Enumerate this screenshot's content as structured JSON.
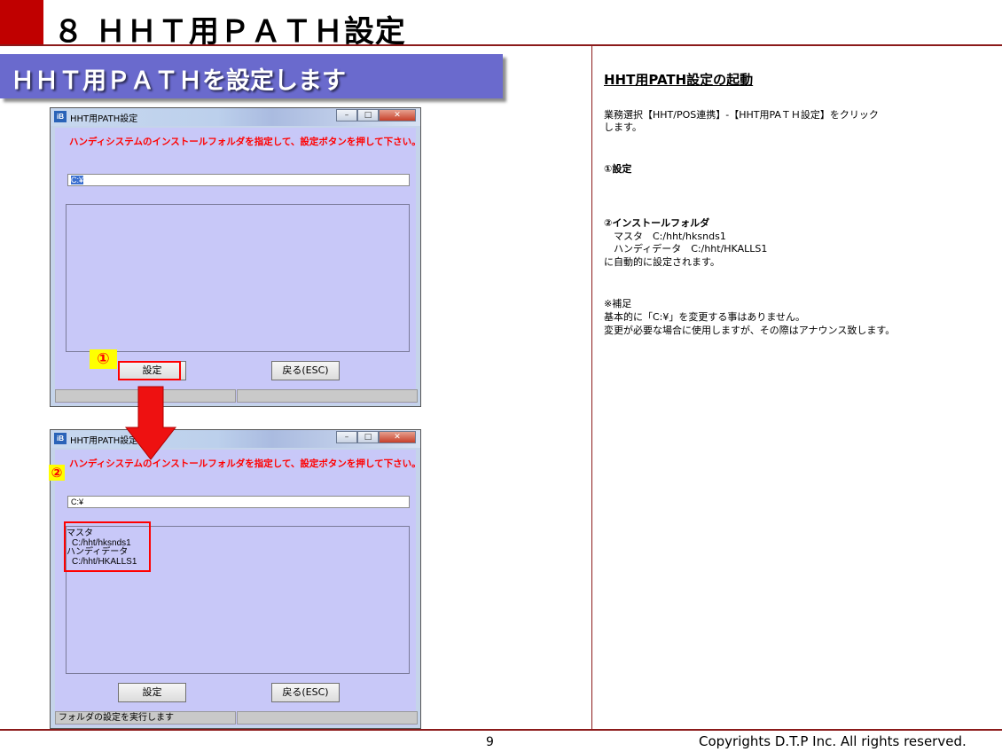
{
  "header": {
    "title": "８ ＨＨＴ用ＰＡＴＨ設定"
  },
  "banner": {
    "text": "ＨＨＴ用ＰＡＴＨを設定します"
  },
  "window1": {
    "title": "HHT用PATH設定",
    "instruction": "ハンディシステムのインストールフォルダを指定して、設定ボタンを押して下さい。",
    "path_value": "C:¥",
    "set_button": "設定",
    "back_button": "戻る(ESC)",
    "status_left": "",
    "status_right": ""
  },
  "window2": {
    "title": "HHT用PATH設定",
    "instruction": "ハンディシステムのインストールフォルダを指定して、設定ボタンを押して下さい。",
    "path_value": "C:¥",
    "list_lines": [
      "マスタ",
      "  C:/hht/hksnds1",
      "ハンディデータ",
      "  C:/hht/HKALLS1"
    ],
    "set_button": "設定",
    "back_button": "戻る(ESC)",
    "status_left": "フォルダの設定を実行します",
    "status_right": ""
  },
  "markers": {
    "step1": "①",
    "step2": "②"
  },
  "colors": {
    "accent_red": "#c00000",
    "banner": "#6a6acd",
    "client_bg": "#c8c8f8",
    "marker_bg": "#ffff00"
  },
  "right_panel": {
    "heading": "HHT用PATH設定の起動",
    "intro_lines": [
      "業務選択【HHT/POS連携】-【HHT用PAＴＨ設定】をクリック",
      "します。"
    ],
    "step1_label": "①設定",
    "step2_label": "②インストールフォルダ",
    "step2_lines": [
      "　マスタ　C:/hht/hksnds1",
      "　ハンディデータ　C:/hht/HKALLS1",
      "に自動的に設定されます。"
    ],
    "note_title": "※補足",
    "note_lines": [
      "基本的に「C:¥」を変更する事はありません。",
      "変更が必要な場合に使用しますが、その際はアナウンス致します。"
    ]
  },
  "footer": {
    "page_number": "9",
    "copyright": "Copyrights  D.T.P Inc. All rights reserved."
  }
}
